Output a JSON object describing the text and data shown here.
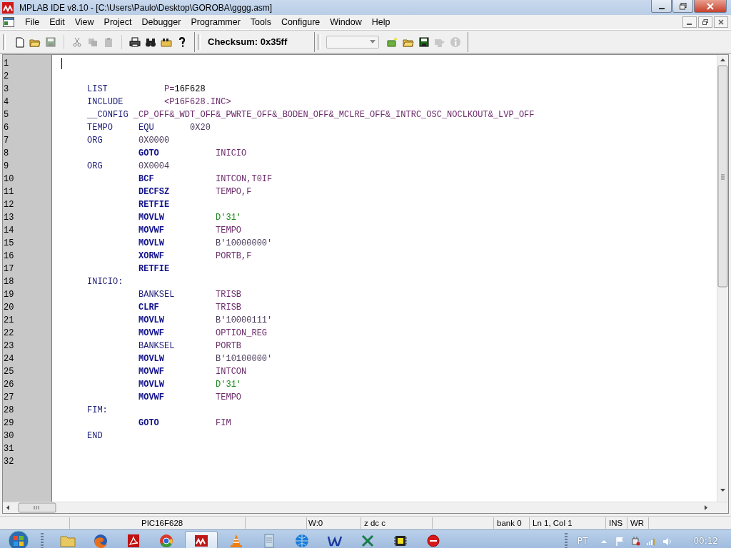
{
  "window": {
    "title": "MPLAB IDE v8.10 - [C:\\Users\\Paulo\\Desktop\\GOROBA\\gggg.asm]"
  },
  "menu": [
    "File",
    "Edit",
    "View",
    "Project",
    "Debugger",
    "Programmer",
    "Tools",
    "Configure",
    "Window",
    "Help"
  ],
  "toolbar": {
    "groups": [
      [
        {
          "kind": "new",
          "disabled": false
        },
        {
          "kind": "open",
          "disabled": false
        },
        {
          "kind": "save",
          "disabled": true
        }
      ],
      [
        {
          "kind": "cut",
          "disabled": true
        },
        {
          "kind": "copy",
          "disabled": true
        },
        {
          "kind": "paste",
          "disabled": true
        }
      ],
      [
        {
          "kind": "print",
          "disabled": false
        },
        {
          "kind": "find",
          "disabled": false
        },
        {
          "kind": "findfiles",
          "disabled": false
        },
        {
          "kind": "help",
          "disabled": false
        }
      ]
    ],
    "checksum": "Checksum: 0x35ff",
    "project_tools": [
      {
        "kind": "newproject",
        "disabled": false
      },
      {
        "kind": "open",
        "disabled": false
      },
      {
        "kind": "save",
        "disabled": false
      },
      {
        "kind": "build",
        "disabled": true
      },
      {
        "kind": "info",
        "disabled": true
      }
    ]
  },
  "editor": {
    "lines": [
      {
        "number": "1"
      },
      {
        "number": "2"
      },
      {
        "number": "3",
        "tokens": [
          {
            "text": "LIST",
            "kind": "directive"
          },
          {
            "text": "           P=",
            "kind": "symbol"
          },
          {
            "text": "16F628",
            "kind": "plain"
          }
        ]
      },
      {
        "number": "4",
        "tokens": [
          {
            "text": "INCLUDE",
            "kind": "directive"
          },
          {
            "text": "        <P16F628.INC>",
            "kind": "symbol"
          }
        ]
      },
      {
        "number": "5",
        "tokens": [
          {
            "text": "__CONFIG",
            "kind": "directive"
          },
          {
            "text": " _CP_OFF&_WDT_OFF&_PWRTE_OFF&_BODEN_OFF&_MCLRE_OFF&_INTRC_OSC_NOCLKOUT&_LVP_OFF",
            "kind": "symbol"
          }
        ]
      },
      {
        "number": "6",
        "tokens": [
          {
            "text": "TEMPO",
            "kind": "label"
          },
          {
            "text": "     EQU",
            "kind": "directive"
          },
          {
            "text": "       0X20",
            "kind": "number"
          }
        ]
      },
      {
        "number": "7",
        "tokens": [
          {
            "text": "ORG",
            "kind": "directive"
          },
          {
            "text": "       0X0000",
            "kind": "number"
          }
        ]
      },
      {
        "number": "8",
        "tokens": [
          {
            "text": "          GOTO",
            "kind": "instruction"
          },
          {
            "text": "           INICIO",
            "kind": "symbol"
          }
        ]
      },
      {
        "number": "9",
        "tokens": [
          {
            "text": "ORG",
            "kind": "directive"
          },
          {
            "text": "       0X0004",
            "kind": "number"
          }
        ]
      },
      {
        "number": "10",
        "tokens": [
          {
            "text": "          BCF",
            "kind": "instruction"
          },
          {
            "text": "            INTCON,T0IF",
            "kind": "symbol"
          }
        ]
      },
      {
        "number": "11",
        "tokens": [
          {
            "text": "          DECFSZ",
            "kind": "instruction"
          },
          {
            "text": "         TEMPO,F",
            "kind": "symbol"
          }
        ]
      },
      {
        "number": "12",
        "tokens": [
          {
            "text": "          RETFIE",
            "kind": "instruction"
          }
        ]
      },
      {
        "number": "13",
        "tokens": [
          {
            "text": "          MOVLW",
            "kind": "instruction"
          },
          {
            "text": "          D'31'",
            "kind": "decimal"
          }
        ]
      },
      {
        "number": "14",
        "tokens": [
          {
            "text": "          MOVWF",
            "kind": "instruction"
          },
          {
            "text": "          TEMPO",
            "kind": "symbol"
          }
        ]
      },
      {
        "number": "15",
        "tokens": [
          {
            "text": "          MOVLW",
            "kind": "instruction"
          },
          {
            "text": "          B'10000000'",
            "kind": "number"
          }
        ]
      },
      {
        "number": "16",
        "tokens": [
          {
            "text": "          XORWF",
            "kind": "instruction"
          },
          {
            "text": "          PORTB,F",
            "kind": "symbol"
          }
        ]
      },
      {
        "number": "17",
        "tokens": [
          {
            "text": "          RETFIE",
            "kind": "instruction"
          }
        ]
      },
      {
        "number": "18",
        "tokens": [
          {
            "text": "INICIO:",
            "kind": "label"
          }
        ]
      },
      {
        "number": "19",
        "tokens": [
          {
            "text": "          BANKSEL",
            "kind": "directive"
          },
          {
            "text": "        TRISB",
            "kind": "symbol"
          }
        ]
      },
      {
        "number": "20",
        "tokens": [
          {
            "text": "          CLRF",
            "kind": "instruction"
          },
          {
            "text": "           TRISB",
            "kind": "symbol"
          }
        ]
      },
      {
        "number": "21",
        "tokens": [
          {
            "text": "          MOVLW",
            "kind": "instruction"
          },
          {
            "text": "          B'10000111'",
            "kind": "number"
          }
        ]
      },
      {
        "number": "22",
        "tokens": [
          {
            "text": "          MOVWF",
            "kind": "instruction"
          },
          {
            "text": "          OPTION_REG",
            "kind": "symbol"
          }
        ]
      },
      {
        "number": "23",
        "tokens": [
          {
            "text": "          BANKSEL",
            "kind": "directive"
          },
          {
            "text": "        PORTB",
            "kind": "symbol"
          }
        ]
      },
      {
        "number": "24",
        "tokens": [
          {
            "text": "          MOVLW",
            "kind": "instruction"
          },
          {
            "text": "          B'10100000'",
            "kind": "number"
          }
        ]
      },
      {
        "number": "25",
        "tokens": [
          {
            "text": "          MOVWF",
            "kind": "instruction"
          },
          {
            "text": "          INTCON",
            "kind": "symbol"
          }
        ]
      },
      {
        "number": "26",
        "tokens": [
          {
            "text": "          MOVLW",
            "kind": "instruction"
          },
          {
            "text": "          D'31'",
            "kind": "decimal"
          }
        ]
      },
      {
        "number": "27",
        "tokens": [
          {
            "text": "          MOVWF",
            "kind": "instruction"
          },
          {
            "text": "          TEMPO",
            "kind": "symbol"
          }
        ]
      },
      {
        "number": "28",
        "tokens": [
          {
            "text": "FIM:",
            "kind": "label"
          }
        ]
      },
      {
        "number": "29",
        "tokens": [
          {
            "text": "          GOTO",
            "kind": "instruction"
          },
          {
            "text": "           FIM",
            "kind": "symbol"
          }
        ]
      },
      {
        "number": "30",
        "tokens": [
          {
            "text": "END",
            "kind": "directive"
          }
        ]
      },
      {
        "number": "31"
      },
      {
        "number": "32"
      }
    ]
  },
  "status_bar": [
    {
      "text": "PIC16F628",
      "kind": "device"
    },
    {
      "kind": "blank"
    },
    {
      "text": "W:0",
      "kind": "register"
    },
    {
      "text": "z dc c",
      "kind": "flags"
    },
    {
      "kind": "blank"
    },
    {
      "text": "bank 0",
      "kind": "bank"
    },
    {
      "text": "Ln 1, Col 1",
      "kind": "position"
    },
    {
      "text": "INS",
      "kind": "mode"
    },
    {
      "text": "WR",
      "kind": "mode"
    }
  ],
  "taskbar": {
    "apps": [
      {
        "kind": "folder",
        "selected": false
      },
      {
        "kind": "firefox",
        "selected": false
      },
      {
        "kind": "pdf",
        "selected": false
      },
      {
        "kind": "chrome",
        "selected": false
      },
      {
        "kind": "mplab",
        "selected": true
      },
      {
        "kind": "vlc",
        "selected": false
      },
      {
        "kind": "notepad",
        "selected": false
      },
      {
        "kind": "globe",
        "selected": false
      },
      {
        "kind": "word",
        "selected": false
      },
      {
        "kind": "excel",
        "selected": false
      },
      {
        "kind": "chip",
        "selected": false
      },
      {
        "kind": "redball",
        "selected": false
      }
    ],
    "language": "PT",
    "clock": "00:12"
  }
}
